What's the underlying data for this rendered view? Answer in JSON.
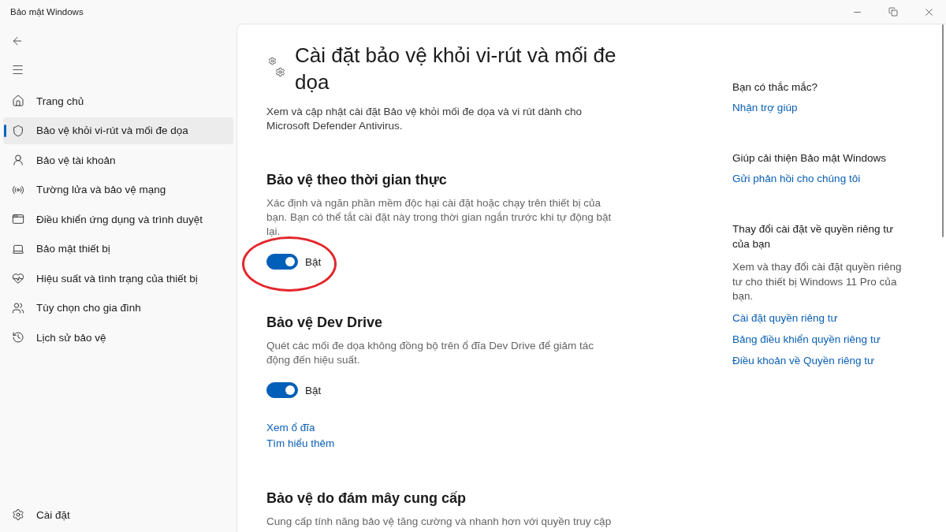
{
  "window": {
    "title": "Bảo mật Windows"
  },
  "sidebar": {
    "items": [
      {
        "label": "Trang chủ",
        "selected": false
      },
      {
        "label": "Bảo vệ khỏi vi-rút và mối đe dọa",
        "selected": true
      },
      {
        "label": "Bảo vệ tài khoản",
        "selected": false
      },
      {
        "label": "Tường lửa và bảo vệ mạng",
        "selected": false
      },
      {
        "label": "Điều khiển ứng dụng và trình duyệt",
        "selected": false
      },
      {
        "label": "Bảo mật thiết bị",
        "selected": false
      },
      {
        "label": "Hiệu suất và tình trạng của thiết bị",
        "selected": false
      },
      {
        "label": "Tùy chọn cho gia đình",
        "selected": false
      },
      {
        "label": "Lịch sử bảo vệ",
        "selected": false
      }
    ],
    "footer_item": {
      "label": "Cài đặt",
      "selected": false
    }
  },
  "page": {
    "title": "Cài đặt bảo vệ khỏi vi-rút và mối đe dọa",
    "description": "Xem và cập nhật cài đặt Bảo vệ khỏi mối đe dọa và vi rút dành cho Microsoft Defender Antivirus."
  },
  "sections": [
    {
      "heading": "Bảo vệ theo thời gian thực",
      "description": "Xác định và ngăn phần mềm độc hại cài đặt hoặc chạy trên thiết bị của bạn. Bạn có thể tắt cài đặt này trong thời gian ngắn trước khi tự động bật lại.",
      "toggle": {
        "on": true,
        "label": "Bật",
        "highlighted": true
      }
    },
    {
      "heading": "Bảo vệ Dev Drive",
      "description": "Quét các mối đe dọa không đồng bộ trên ổ đĩa Dev Drive để giảm tác động đến hiệu suất.",
      "toggle": {
        "on": true,
        "label": "Bật",
        "highlighted": false
      },
      "links": [
        "Xem ổ đĩa",
        "Tìm hiểu thêm"
      ]
    },
    {
      "heading": "Bảo vệ do đám mây cung cấp",
      "description": "Cung cấp tính năng bảo vệ tăng cường và nhanh hơn với quyền truy cập"
    }
  ],
  "aside": {
    "groups": [
      {
        "heading": "Bạn có thắc mắc?",
        "links": [
          "Nhận trợ giúp"
        ]
      },
      {
        "heading": "Giúp cải thiện Bảo mật Windows",
        "links": [
          "Gửi phản hồi cho chúng tôi"
        ]
      },
      {
        "heading": "Thay đổi cài đặt về quyền riêng tư của bạn",
        "description": "Xem và thay đổi cài đặt quyền riêng tư cho thiết bị Windows 11 Pro của bạn.",
        "links": [
          "Cài đặt quyền riêng tư",
          "Bảng điều khiển quyền riêng tư",
          "Điều khoản về Quyền riêng tư"
        ]
      }
    ]
  }
}
